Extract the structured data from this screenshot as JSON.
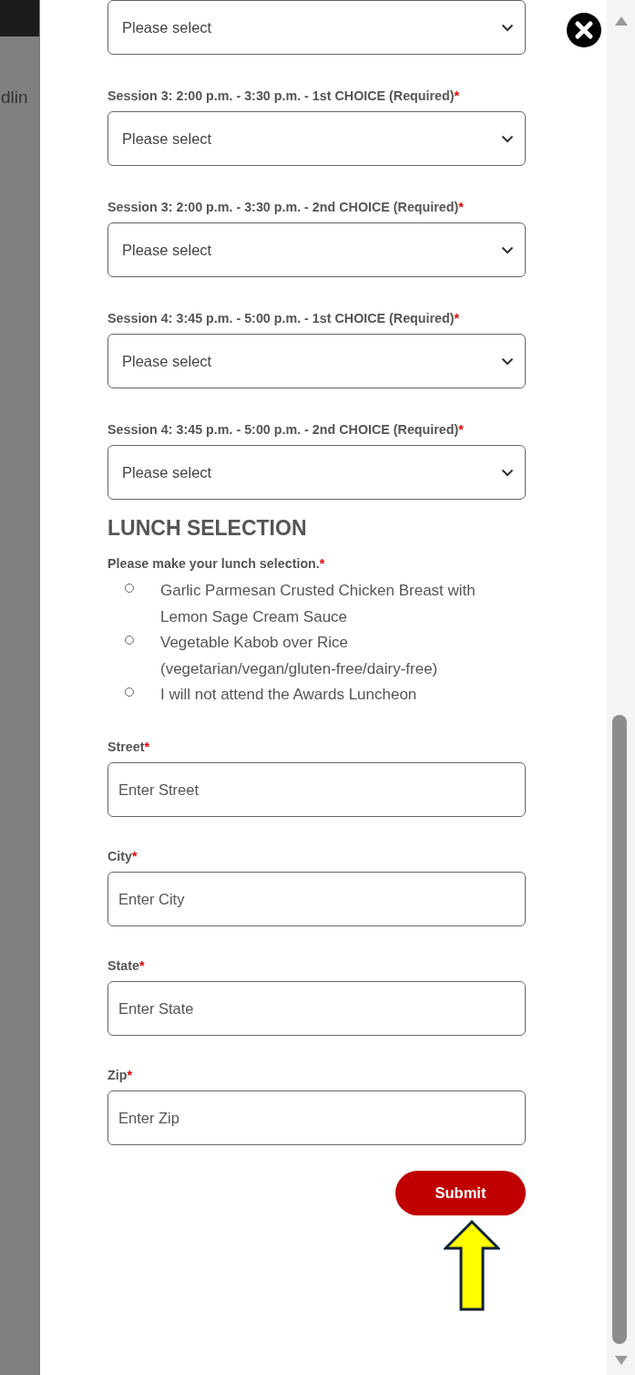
{
  "background_page": {
    "text": "dlin"
  },
  "top_select": {
    "placeholder": "Please select"
  },
  "session_selects": [
    {
      "label": "Session 3: 2:00 p.m. - 3:30 p.m. - 1st CHOICE (Required)",
      "required_mark": "*",
      "placeholder": "Please select"
    },
    {
      "label": "Session 3: 2:00 p.m. - 3:30 p.m. - 2nd CHOICE (Required)",
      "required_mark": "*",
      "placeholder": "Please select"
    },
    {
      "label": "Session 4: 3:45 p.m. - 5:00 p.m. - 1st CHOICE (Required)",
      "required_mark": "*",
      "placeholder": "Please select"
    },
    {
      "label": "Session 4: 3:45 p.m. - 5:00 p.m. - 2nd CHOICE (Required)",
      "required_mark": "*",
      "placeholder": "Please select"
    }
  ],
  "lunch": {
    "heading": "LUNCH SELECTION",
    "prompt": "Please make your lunch selection.",
    "required_mark": "*",
    "options": [
      {
        "label": "Garlic Parmesan Crusted Chicken Breast with Lemon Sage Cream Sauce",
        "selected": false
      },
      {
        "label": "Vegetable Kabob over Rice (vegetarian/vegan/gluten-free/dairy-free)",
        "selected": false
      },
      {
        "label": "I will not attend the Awards Luncheon",
        "selected": false
      }
    ]
  },
  "address_fields": [
    {
      "label": "Street",
      "required_mark": "*",
      "placeholder": "Enter Street"
    },
    {
      "label": "City",
      "required_mark": "*",
      "placeholder": "Enter City"
    },
    {
      "label": "State",
      "required_mark": "*",
      "placeholder": "Enter State"
    },
    {
      "label": "Zip",
      "required_mark": "*",
      "placeholder": "Enter Zip"
    }
  ],
  "submit_button": {
    "label": "Submit"
  }
}
